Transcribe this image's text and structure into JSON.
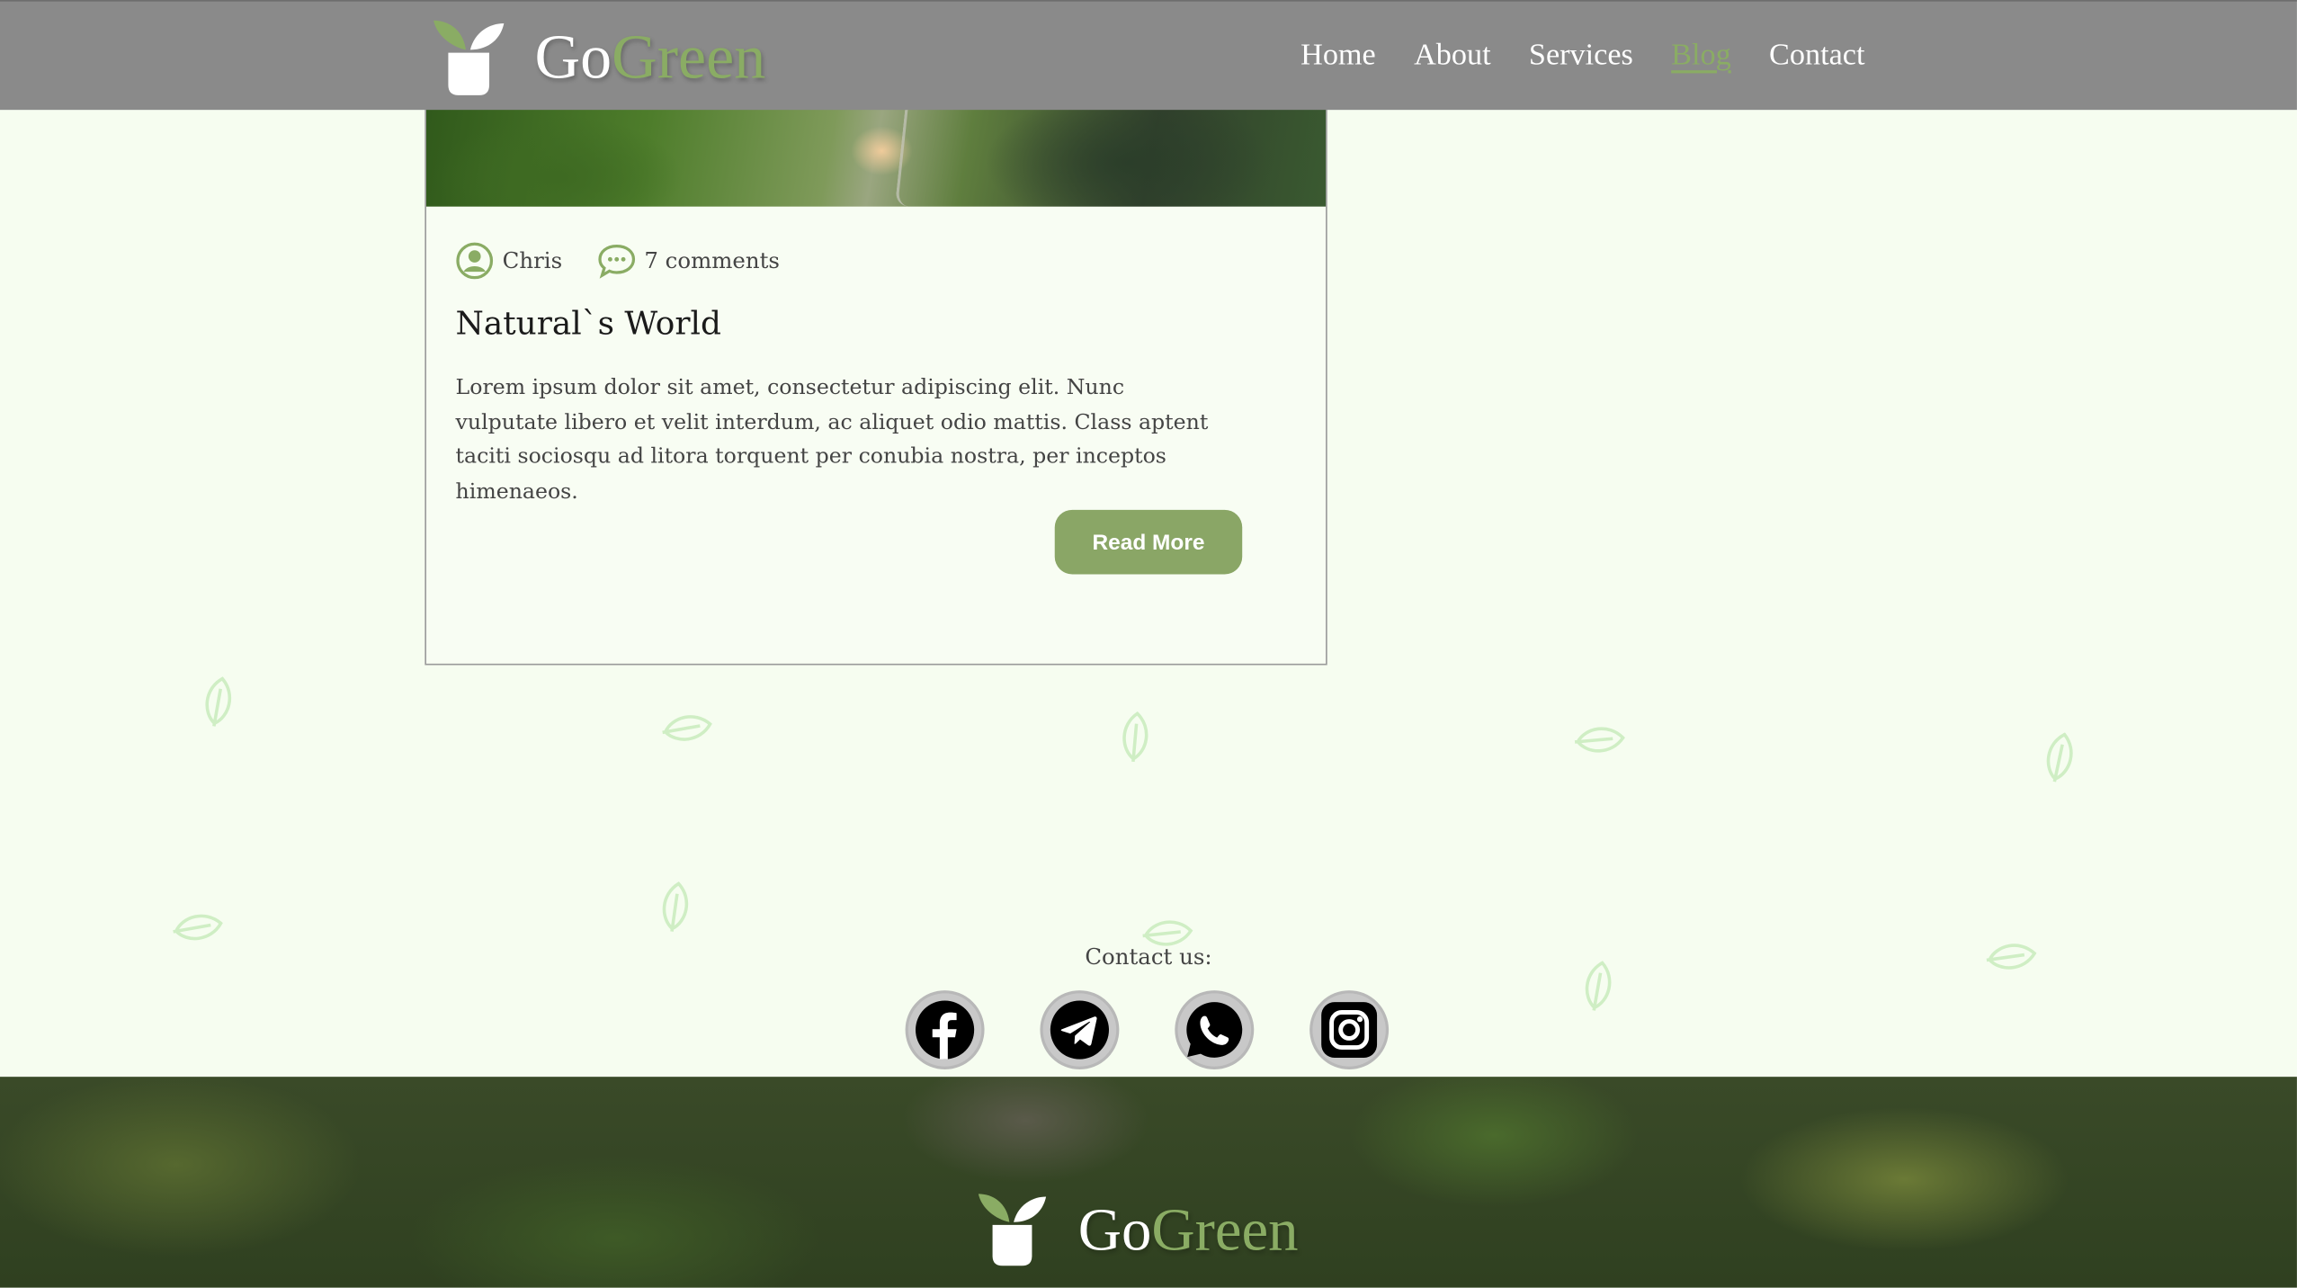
{
  "brand": {
    "name_part1": "Go",
    "name_part2": "Green"
  },
  "nav": {
    "items": [
      {
        "label": "Home",
        "active": false
      },
      {
        "label": "About",
        "active": false
      },
      {
        "label": "Services",
        "active": false
      },
      {
        "label": "Blog",
        "active": true
      },
      {
        "label": "Contact",
        "active": false
      }
    ]
  },
  "post": {
    "author": "Chris",
    "comments": "7 comments",
    "title": "Natural`s World",
    "body": "Lorem ipsum dolor sit amet, consectetur adipiscing elit. Nunc vulputate libero et velit interdum, ac aliquet odio mattis. Class aptent taciti sociosqu ad litora torquent per conubia nostra, per inceptos himenaeos.",
    "read_more_label": "Read More"
  },
  "contact": {
    "label": "Contact us:",
    "socials": [
      {
        "name": "facebook-icon"
      },
      {
        "name": "telegram-icon"
      },
      {
        "name": "whatsapp-icon"
      },
      {
        "name": "instagram-icon"
      }
    ]
  },
  "colors": {
    "accent": "#8aac64",
    "header_bg": "#8a8a8a",
    "page_bg": "#f6fdf0",
    "button_bg": "#8aa666"
  }
}
